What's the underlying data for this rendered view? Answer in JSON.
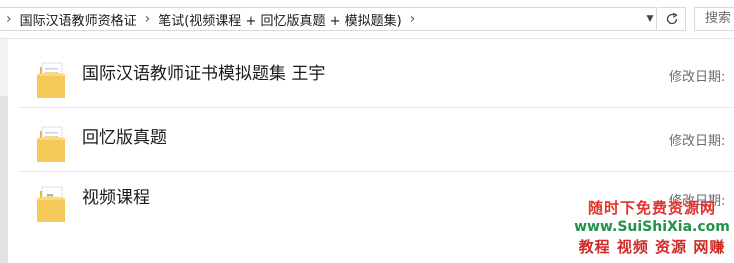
{
  "breadcrumb": {
    "items": [
      "国际汉语教师资格证",
      "笔试(视频课程 + 回忆版真题 + 模拟题集)"
    ]
  },
  "search": {
    "placeholder": "搜索"
  },
  "files": [
    {
      "name": "国际汉语教师证书模拟题集 王宇",
      "modified_label": "修改日期:"
    },
    {
      "name": "回忆版真题",
      "modified_label": "修改日期:"
    },
    {
      "name": "视频课程",
      "modified_label": "修改日期:"
    }
  ],
  "watermark": {
    "line1": "随时下免费资源网",
    "line2": "www.SuiShiXia.com",
    "line3": "教程 视频 资源 网赚"
  },
  "colors": {
    "folder": "#f4c95a",
    "accent": "#0078d7"
  }
}
